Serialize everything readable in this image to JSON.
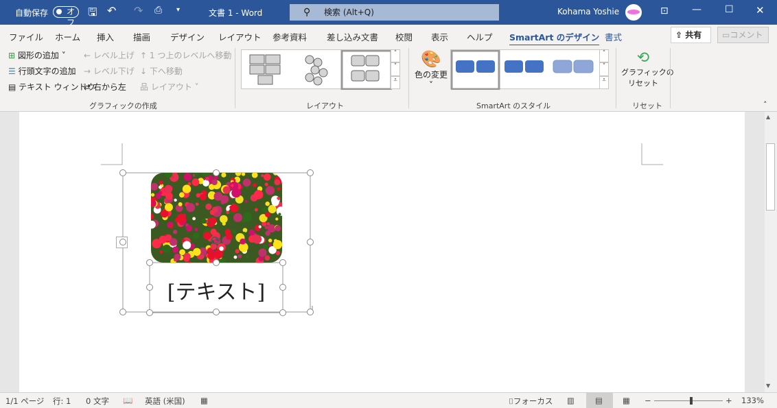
{
  "titlebar": {
    "autosave": "自動保存",
    "autosave_state": "オフ",
    "doc_title": "文書 1  -  Word",
    "search_placeholder": "検索 (Alt+Q)",
    "user": "Kohama Yoshie"
  },
  "tabs": [
    "ファイル",
    "ホーム",
    "挿入",
    "描画",
    "デザイン",
    "レイアウト",
    "参考資料",
    "差し込み文書",
    "校閲",
    "表示",
    "ヘルプ",
    "SmartArt のデザイン",
    "書式"
  ],
  "active_tab": "SmartArt のデザイン",
  "share_label": "共有",
  "comment_label": "コメント",
  "ribbon": {
    "create": {
      "add_shape": "図形の追加",
      "add_bullet": "行頭文字の追加",
      "text_pane": "テキスト ウィンドウ",
      "promote": "レベル上げ",
      "demote": "レベル下げ",
      "move_up": "1 つ上のレベルへ移動",
      "move_down": "下へ移動",
      "rtl": "右から左",
      "layout": "レイアウト",
      "group": "グラフィックの作成"
    },
    "layouts": {
      "group": "レイアウト"
    },
    "styles": {
      "change_colors": "色の変更",
      "group": "SmartArt のスタイル"
    },
    "reset": {
      "reset_graphic_1": "グラフィックの",
      "reset_graphic_2": "リセット",
      "group": "リセット"
    }
  },
  "smartart": {
    "placeholder": "[テキスト]"
  },
  "status": {
    "page": "1/1 ページ",
    "line": "行: 1",
    "words": "0 文字",
    "language": "英語 (米国)",
    "focus": "フォーカス",
    "zoom": "133%",
    "zoom_level_percent": 133
  },
  "colors": {
    "titlebar": "#2b579a",
    "accent": "#4472c4"
  }
}
